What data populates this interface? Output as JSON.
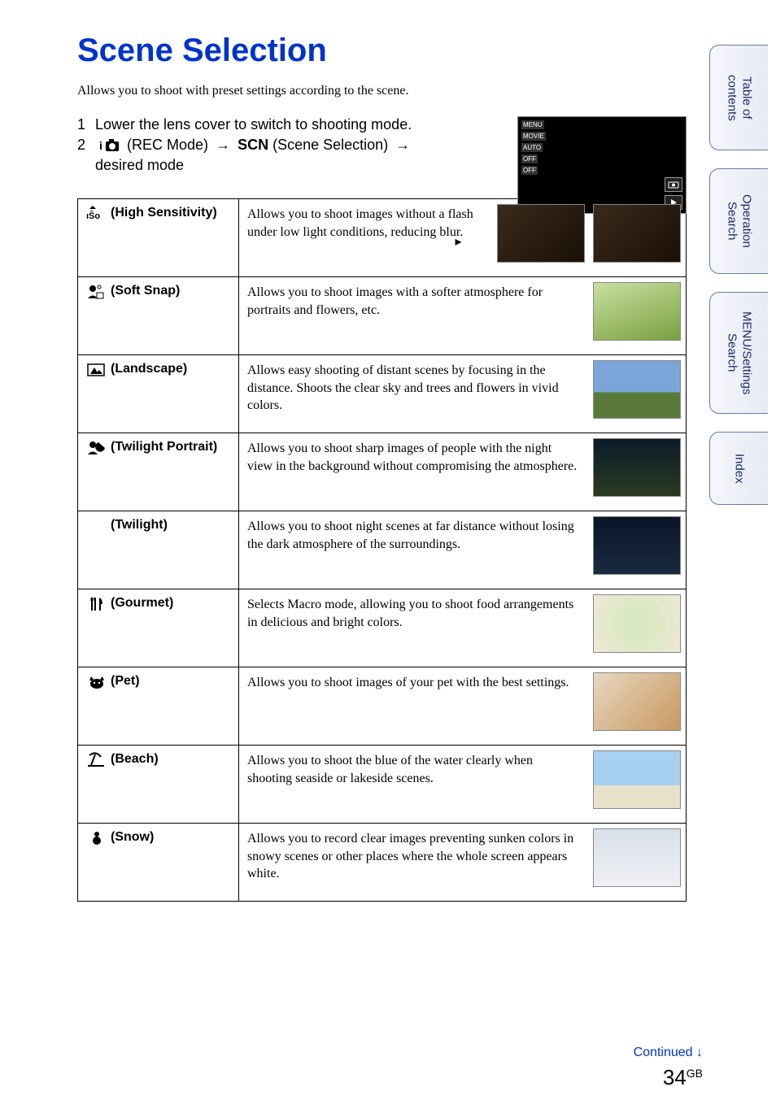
{
  "title": "Scene Selection",
  "intro": "Allows you to shoot with preset settings according to the scene.",
  "steps": [
    {
      "num": "1",
      "text": "Lower the lens cover to switch to shooting mode."
    },
    {
      "num": "2",
      "rec_label": "(REC Mode)",
      "scn_label": "(Scene Selection)",
      "sub": "desired mode"
    }
  ],
  "scn_glyph": "SCN",
  "modes": [
    {
      "name": "(High Sensitivity)",
      "icon": "iso",
      "desc": "Allows you to shoot images without a flash under low light conditions, reducing blur.",
      "wide": true
    },
    {
      "name": "(Soft Snap)",
      "icon": "softsnap",
      "desc": "Allows you to shoot images with a softer atmosphere for portraits and flowers, etc."
    },
    {
      "name": "(Landscape)",
      "icon": "landscape",
      "desc": "Allows easy shooting of distant scenes by focusing in the distance. Shoots the clear sky and trees and flowers in vivid colors."
    },
    {
      "name": "(Twilight Portrait)",
      "icon": "twilight-portrait",
      "desc": "Allows you to shoot sharp images of people with the night view in the background without compromising the atmosphere."
    },
    {
      "name": "(Twilight)",
      "icon": "twilight",
      "desc": "Allows you to shoot night scenes at far distance without losing the dark atmosphere of the surroundings."
    },
    {
      "name": "(Gourmet)",
      "icon": "gourmet",
      "desc": "Selects Macro mode, allowing you to shoot food arrangements in delicious and bright colors."
    },
    {
      "name": "(Pet)",
      "icon": "pet",
      "desc": "Allows you to shoot images of your pet with the best settings."
    },
    {
      "name": "(Beach)",
      "icon": "beach",
      "desc": "Allows you to shoot the blue of the water clearly when shooting seaside or lakeside scenes."
    },
    {
      "name": "(Snow)",
      "icon": "snow",
      "desc": "Allows you to record clear images preventing sunken colors in snowy scenes or other places where the whole screen appears white."
    }
  ],
  "side_tabs": [
    "Table of contents",
    "Operation Search",
    "MENU/Settings Search",
    "Index"
  ],
  "continued": "Continued",
  "page_number": "34",
  "page_region": "GB",
  "screenshot_menu": [
    "MENU",
    "MOVIE",
    "AUTO",
    "OFF",
    "OFF"
  ]
}
